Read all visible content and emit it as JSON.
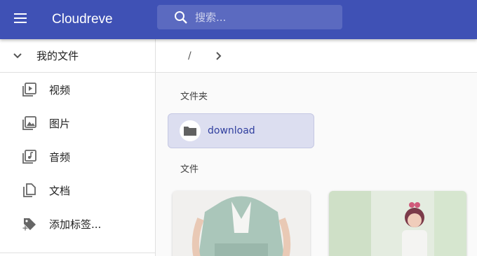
{
  "app": {
    "title": "Cloudreve"
  },
  "search": {
    "placeholder": "搜索..."
  },
  "sidebar": {
    "my_files": "我的文件",
    "items": [
      {
        "label": "视频",
        "icon": "video-icon"
      },
      {
        "label": "图片",
        "icon": "image-icon"
      },
      {
        "label": "音频",
        "icon": "audio-icon"
      },
      {
        "label": "文档",
        "icon": "document-icon"
      },
      {
        "label": "添加标签...",
        "icon": "add-tag-icon"
      }
    ]
  },
  "breadcrumb": {
    "root": "/"
  },
  "main": {
    "folders_title": "文件夹",
    "files_title": "文件",
    "folders": [
      {
        "name": "download"
      }
    ]
  },
  "colors": {
    "primary": "#3f51b5",
    "folder_selected_bg": "#dcdef0"
  }
}
